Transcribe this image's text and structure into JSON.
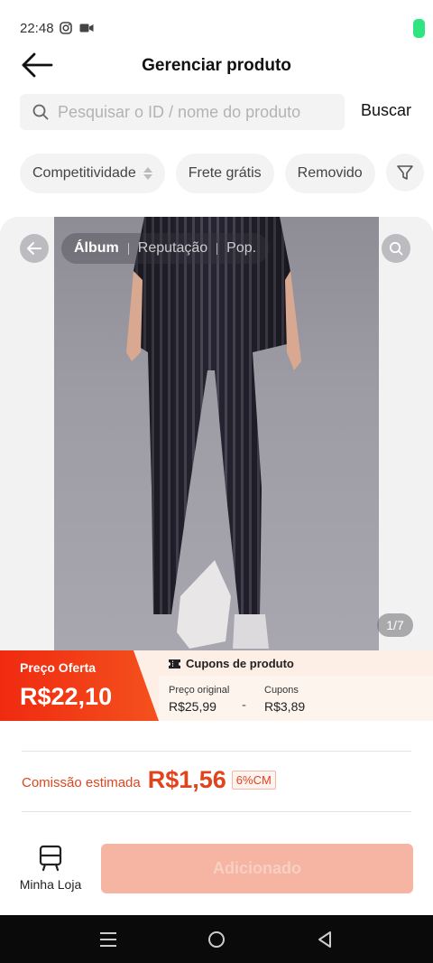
{
  "status_bar": {
    "time": "22:48"
  },
  "header": {
    "title": "Gerenciar produto"
  },
  "search": {
    "placeholder": "Pesquisar o ID / nome do produto",
    "button_label": "Buscar"
  },
  "filters": {
    "chips": [
      "Competitividade",
      "Frete grátis",
      "Removido"
    ]
  },
  "gallery": {
    "tabs": [
      "Álbum",
      "Reputação",
      "Pop."
    ],
    "active_tab": "Álbum",
    "page_counter": "1/7",
    "image_alt": "Leggings pretas com listras verticais vistas de costas"
  },
  "price": {
    "offer_label": "Preço Oferta",
    "offer_price": "R$22,10",
    "coupon_title": "Cupons de produto",
    "original_label": "Preço original",
    "original_value": "R$25,99",
    "minus": "-",
    "coupons_label": "Cupons",
    "coupons_value": "R$3,89"
  },
  "commission": {
    "label": "Comissão estimada",
    "value": "R$1,56",
    "badge": "6%CM"
  },
  "actions": {
    "my_store_label": "Minha Loja",
    "add_button_label": "Adicionado"
  },
  "colors": {
    "accent": "#e0441d",
    "offer_gradient_start": "#f02a10",
    "add_button_bg": "#f6b4a2",
    "battery": "#2ee57f"
  },
  "icons": {
    "back": "arrow-left-icon",
    "search": "search-icon",
    "filter": "funnel-icon",
    "store": "store-icon",
    "coupon": "ticket-icon"
  }
}
